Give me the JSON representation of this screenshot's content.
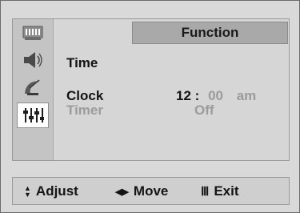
{
  "menu": {
    "title": "Function",
    "section_label": "Time",
    "rows": [
      {
        "label": "Clock",
        "hour": "12",
        "sep": ":",
        "minute": "00",
        "ampm": "am",
        "active": true
      },
      {
        "label": "Timer",
        "value": "Off",
        "active": false
      }
    ]
  },
  "side_icons": [
    {
      "name": "picture-icon",
      "active": false
    },
    {
      "name": "speaker-icon",
      "active": false
    },
    {
      "name": "antenna-icon",
      "active": false
    },
    {
      "name": "function-sliders-icon",
      "active": true
    }
  ],
  "footer": {
    "adjust_label": "Adjust",
    "move_label": "Move",
    "exit_label": "Exit",
    "adjust_glyph": "▲▼",
    "move_glyph": "◀▶",
    "exit_glyph": "Ⅲ"
  },
  "colors": {
    "panel": "#d6d6d6",
    "title_bar": "#a9a9a9",
    "active_text": "#141414",
    "dim_text": "#9b9b9b"
  }
}
